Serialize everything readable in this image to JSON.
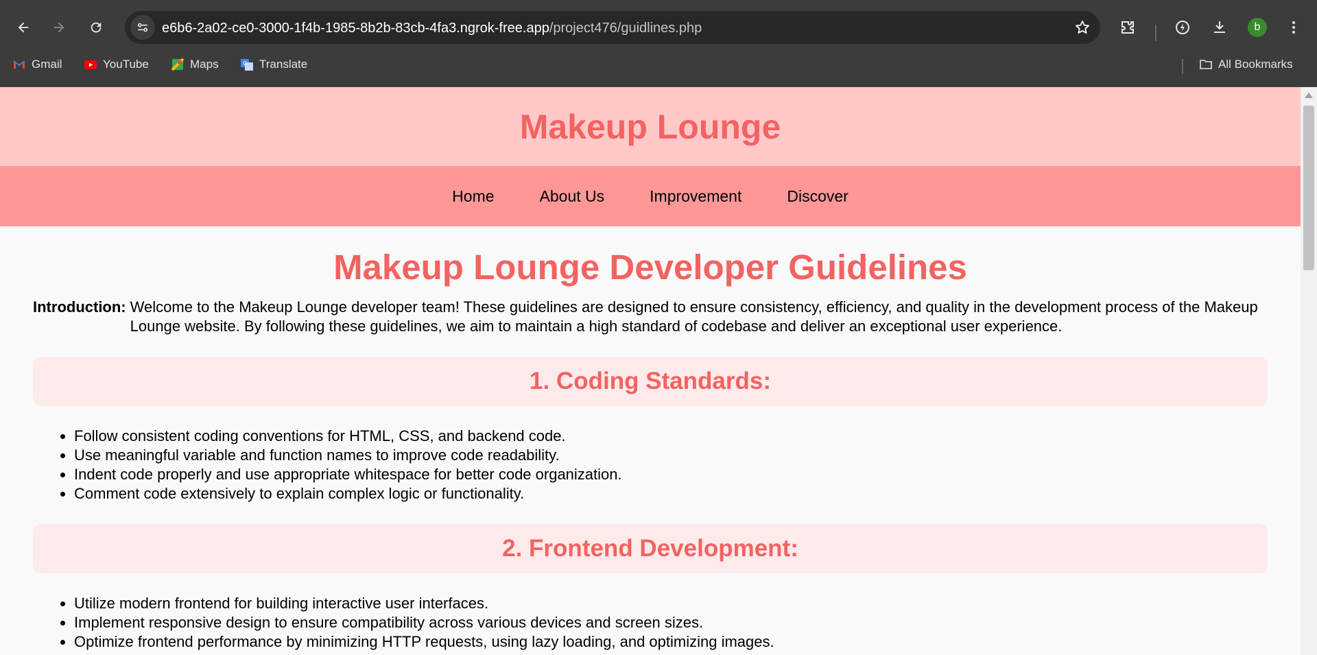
{
  "browser": {
    "url_host": "e6b6-2a02-ce0-3000-1f4b-1985-8b2b-83cb-4fa3.ngrok-free.app",
    "url_path": "/project476/guidlines.php",
    "profile_initial": "b",
    "bookmarks": [
      {
        "label": "Gmail",
        "icon": "gmail-icon"
      },
      {
        "label": "YouTube",
        "icon": "youtube-icon"
      },
      {
        "label": "Maps",
        "icon": "maps-icon"
      },
      {
        "label": "Translate",
        "icon": "translate-icon"
      }
    ],
    "all_bookmarks_label": "All Bookmarks"
  },
  "site": {
    "title": "Makeup Lounge",
    "nav": [
      "Home",
      "About Us",
      "Improvement",
      "Discover"
    ]
  },
  "main": {
    "heading": "Makeup Lounge Developer Guidelines",
    "intro_label": "Introduction:",
    "intro_text": "Welcome to the Makeup Lounge developer team! These guidelines are designed to ensure consistency, efficiency, and quality in the development process of the Makeup Lounge website. By following these guidelines, we aim to maintain a high standard of codebase and deliver an exceptional user experience.",
    "sections": [
      {
        "title": "1. Coding Standards:",
        "items": [
          "Follow consistent coding conventions for HTML, CSS, and backend code.",
          "Use meaningful variable and function names to improve code readability.",
          "Indent code properly and use appropriate whitespace for better code organization.",
          "Comment code extensively to explain complex logic or functionality."
        ]
      },
      {
        "title": "2. Frontend Development:",
        "items": [
          "Utilize modern frontend for building interactive user interfaces.",
          "Implement responsive design to ensure compatibility across various devices and screen sizes.",
          "Optimize frontend performance by minimizing HTTP requests, using lazy loading, and optimizing images."
        ]
      }
    ]
  },
  "colors": {
    "header_bg": "#ffc9c9",
    "nav_bg": "#ff9797",
    "accent": "#f26361",
    "section_bg": "#fdeaea"
  }
}
